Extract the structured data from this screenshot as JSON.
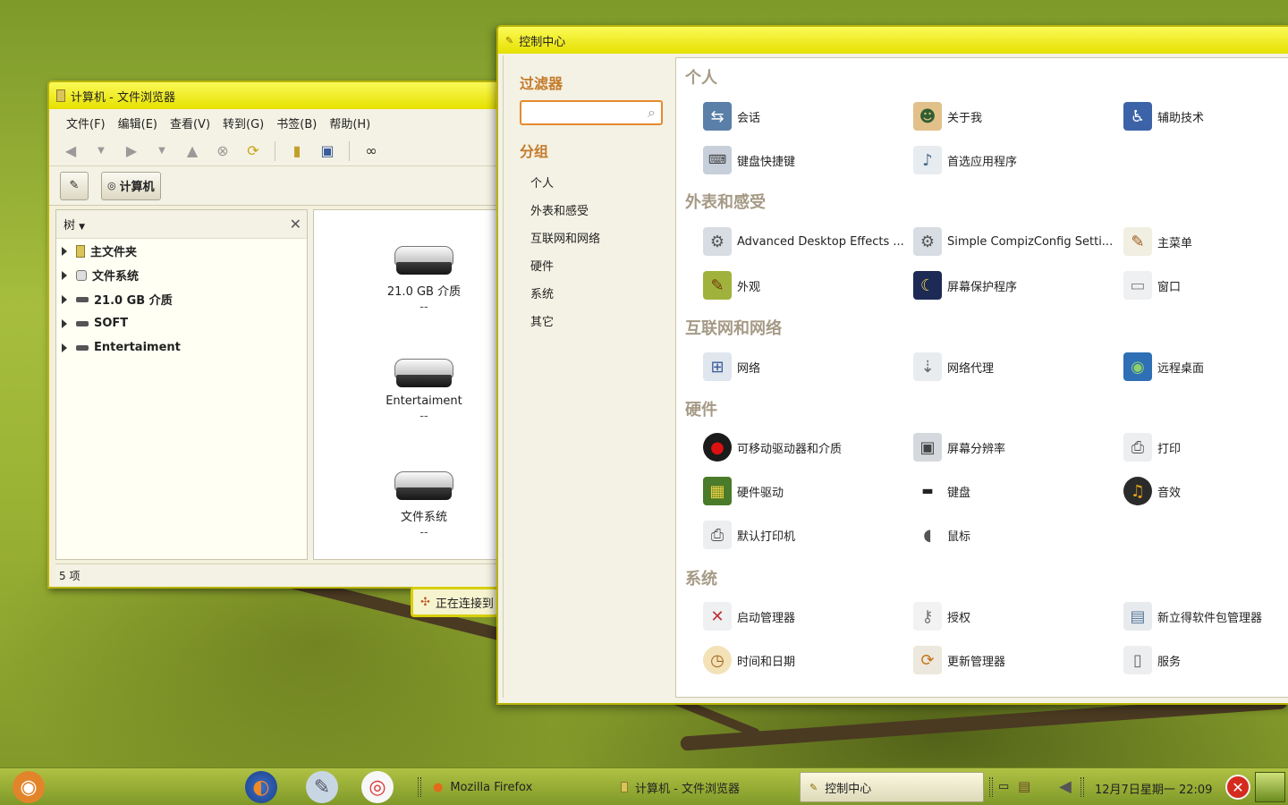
{
  "file_browser": {
    "title": "计算机 - 文件浏览器",
    "menu": [
      "文件(F)",
      "编辑(E)",
      "查看(V)",
      "转到(G)",
      "书签(B)",
      "帮助(H)"
    ],
    "location_button": "计算机",
    "sidebar_mode": "树",
    "tree": [
      "主文件夹",
      "文件系统",
      "21.0 GB 介质",
      "SOFT",
      "Entertaiment"
    ],
    "drives": [
      {
        "name": "21.0 GB 介质",
        "sub": "--"
      },
      {
        "name": "Entertaiment",
        "sub": "--"
      },
      {
        "name": "文件系统",
        "sub": "--"
      }
    ],
    "status": "5 项"
  },
  "notification": {
    "text": "正在连接到"
  },
  "control_center": {
    "title": "控制中心",
    "filter_label": "过滤器",
    "search_value": "",
    "group_label": "分组",
    "groups": [
      "个人",
      "外表和感受",
      "互联网和网络",
      "硬件",
      "系统",
      "其它"
    ],
    "categories": {
      "personal": {
        "title": "个人",
        "items": [
          "会话",
          "关于我",
          "辅助技术",
          "键盘快捷键",
          "首选应用程序"
        ]
      },
      "appearance": {
        "title": "外表和感受",
        "items": [
          "Advanced Desktop Effects ...",
          "Simple CompizConfig Setti...",
          "主菜单",
          "外观",
          "屏幕保护程序",
          "窗口"
        ]
      },
      "internet": {
        "title": "互联网和网络",
        "items": [
          "网络",
          "网络代理",
          "远程桌面"
        ]
      },
      "hardware": {
        "title": "硬件",
        "items": [
          "可移动驱动器和介质",
          "屏幕分辨率",
          "打印",
          "硬件驱动",
          "键盘",
          "音效",
          "默认打印机",
          "鼠标"
        ]
      },
      "system": {
        "title": "系统",
        "items": [
          "启动管理器",
          "授权",
          "新立得软件包管理器",
          "时间和日期",
          "更新管理器",
          "服务"
        ]
      }
    }
  },
  "taskbar": {
    "tasks": [
      "Mozilla Firefox",
      "计算机 - 文件浏览器",
      "控制中心"
    ],
    "clock": "12月7日星期一 22:09"
  }
}
